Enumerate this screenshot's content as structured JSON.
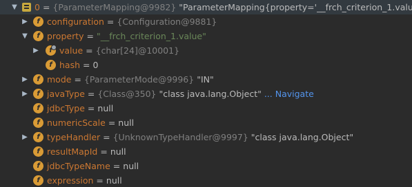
{
  "rows": [
    {
      "expanded": true,
      "icon": "array-icon",
      "name": "0",
      "ref": "{ParameterMapping@9982}",
      "value": "\"ParameterMapping{property='__frch_criterion_1.value', mo",
      "more": "V"
    },
    {
      "expanded": false,
      "icon": "field-icon",
      "name": "configuration",
      "ref": "{Configuration@9881}",
      "value": ""
    },
    {
      "expanded": true,
      "icon": "field-icon",
      "name": "property",
      "strval": "\"__frch_criterion_1.value\""
    },
    {
      "expanded": false,
      "icon": "final-field-icon",
      "name": "value",
      "ref": "{char[24]@10001}",
      "value": ""
    },
    {
      "icon": "field-icon",
      "name": "hash",
      "value": "0"
    },
    {
      "expanded": false,
      "icon": "field-icon",
      "name": "mode",
      "ref": "{ParameterMode@9996}",
      "value": "\"IN\""
    },
    {
      "expanded": false,
      "icon": "field-icon",
      "name": "javaType",
      "ref": "{Class@350}",
      "value": "\"class java.lang.Object\"",
      "nav": "... Navigate"
    },
    {
      "icon": "field-icon",
      "name": "jdbcType",
      "value": "null"
    },
    {
      "icon": "field-icon",
      "name": "numericScale",
      "value": "null"
    },
    {
      "expanded": false,
      "icon": "field-icon",
      "name": "typeHandler",
      "ref": "{UnknownTypeHandler@9997}",
      "value": "\"class java.lang.Object\""
    },
    {
      "icon": "field-icon",
      "name": "resultMapId",
      "value": "null"
    },
    {
      "icon": "field-icon",
      "name": "jdbcTypeName",
      "value": "null"
    },
    {
      "icon": "field-icon",
      "name": "expression",
      "value": "null"
    }
  ],
  "glyphs": {
    "expanded": "▼",
    "collapsed": "▶",
    "field_letter": "f",
    "equals": "="
  }
}
